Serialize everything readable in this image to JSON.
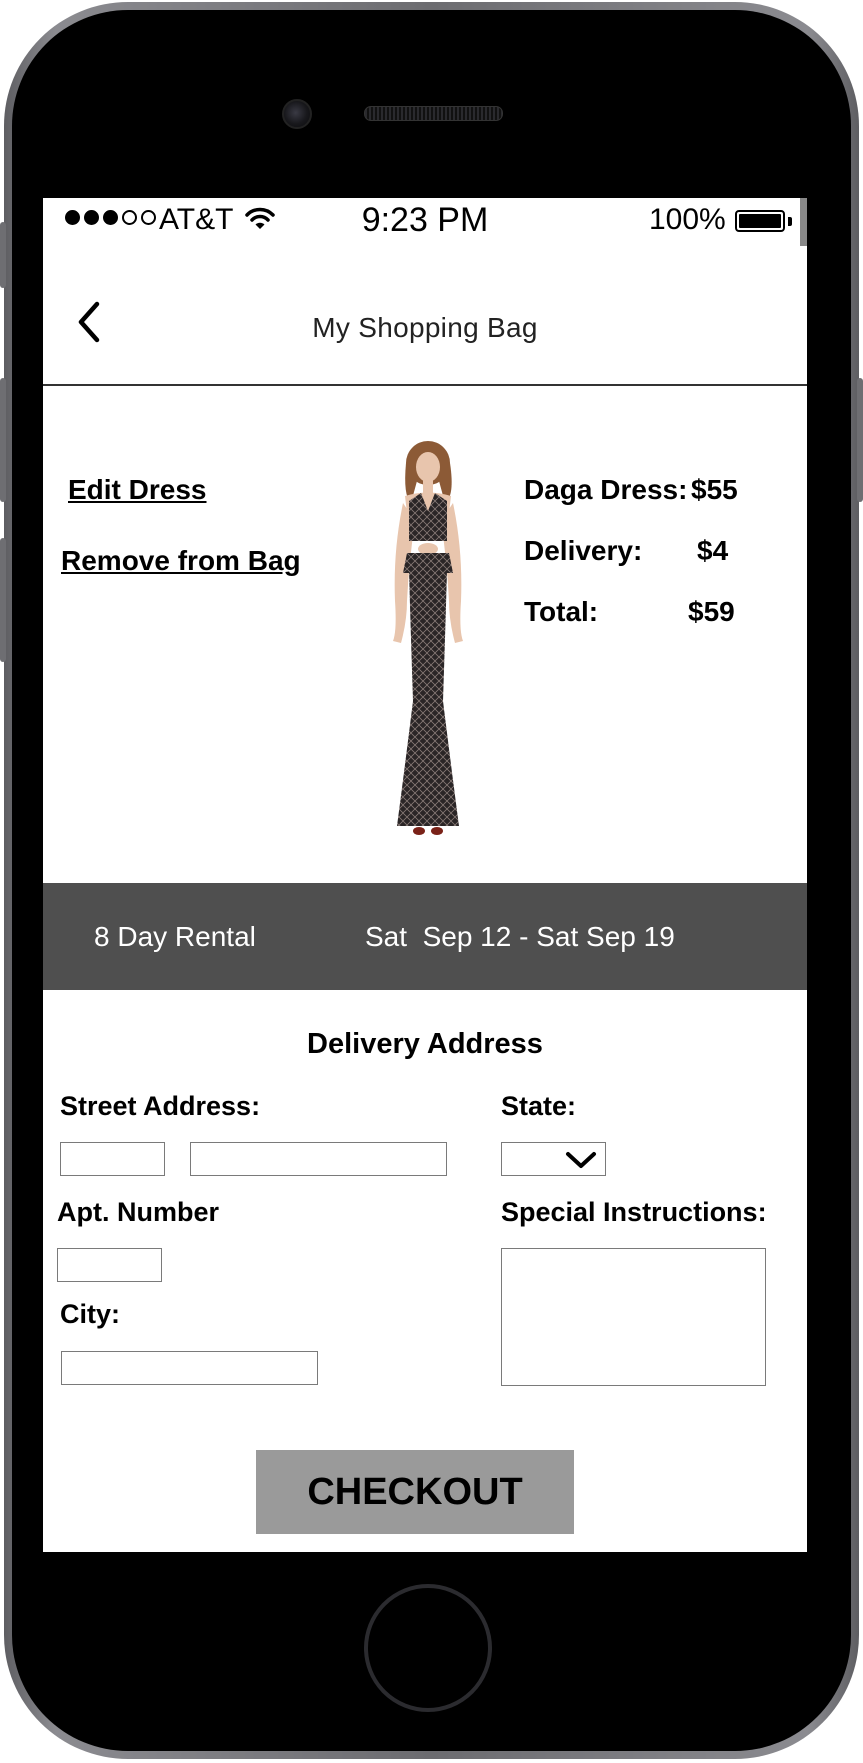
{
  "status_bar": {
    "signal_filled": 3,
    "signal_total": 5,
    "carrier": "AT&T",
    "time": "9:23 PM",
    "battery_percent": "100%",
    "battery_level": 1.0
  },
  "header": {
    "back_icon": "chevron-left-icon",
    "title": "My Shopping Bag"
  },
  "item": {
    "edit_label": "Edit Dress",
    "remove_label": "Remove from Bag",
    "image": "black-lace-gown-photo",
    "price_rows": [
      {
        "label": "Daga Dress:",
        "value": "$55"
      },
      {
        "label": "Delivery:",
        "value": "$4"
      },
      {
        "label": "Total:",
        "value": "$59"
      }
    ]
  },
  "rental": {
    "duration": "8 Day Rental",
    "dates": "Sat  Sep 12 - Sat Sep 19"
  },
  "delivery": {
    "title": "Delivery Address",
    "street_label": "Street Address:",
    "street_number_value": "",
    "street_name_value": "",
    "apt_label": "Apt. Number",
    "apt_value": "",
    "city_label": "City:",
    "city_value": "",
    "state_label": "State:",
    "state_value": "",
    "state_icon": "chevron-down-icon",
    "instructions_label": "Special Instructions:",
    "instructions_value": ""
  },
  "checkout_label": "CHECKOUT",
  "colors": {
    "rental_bar": "#4f4f4f",
    "checkout_button": "#9a9a9a",
    "frame": "#7a7a7e"
  }
}
